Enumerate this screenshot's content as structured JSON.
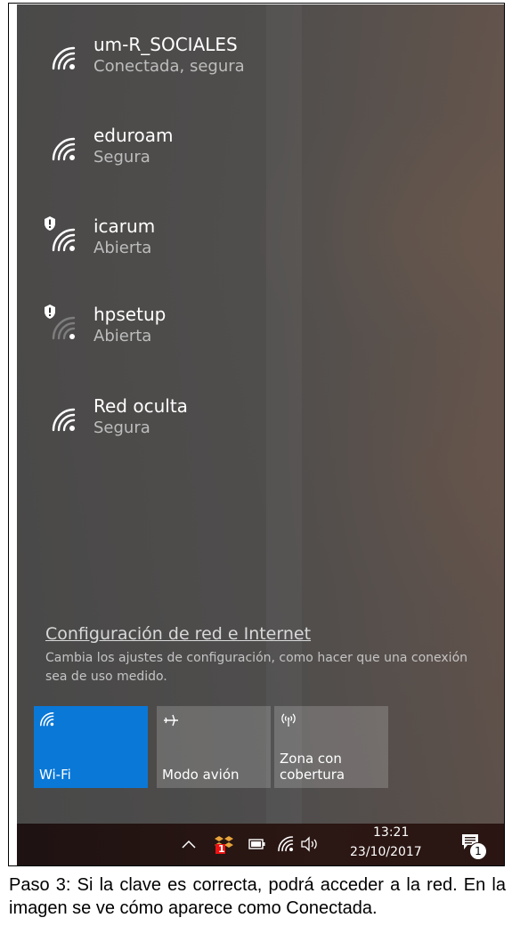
{
  "networks": [
    {
      "name": "um-R_SOCIALES",
      "status": "Conectada, segura",
      "icon": "wifi-icon",
      "shield": false
    },
    {
      "name": "eduroam",
      "status": "Segura",
      "icon": "wifi-icon",
      "shield": false
    },
    {
      "name": "icarum",
      "status": "Abierta",
      "icon": "wifi-icon",
      "shield": true
    },
    {
      "name": "hpsetup",
      "status": "Abierta",
      "icon": "wifi-weak-icon",
      "shield": true
    },
    {
      "name": "Red oculta",
      "status": "Segura",
      "icon": "wifi-icon",
      "shield": false
    }
  ],
  "settings": {
    "title": "Configuración de red e Internet",
    "description": "Cambia los ajustes de configuración, como hacer que una conexión sea de uso medido."
  },
  "quick_actions": [
    {
      "label": "Wi-Fi",
      "icon": "wifi-icon",
      "active": true
    },
    {
      "label": "Modo avión",
      "icon": "airplane-icon",
      "active": false
    },
    {
      "label": "Zona con cobertura",
      "icon": "hotspot-icon",
      "active": false
    }
  ],
  "taskbar": {
    "time": "13:21",
    "date": "23/10/2017",
    "notification_count": "1",
    "dropbox_badge": "1"
  },
  "colors": {
    "accent": "#0a78d7"
  },
  "caption": "Paso 3: Si la clave es correcta, podrá acceder a la red. En la imagen se ve cómo aparece como Conectada."
}
